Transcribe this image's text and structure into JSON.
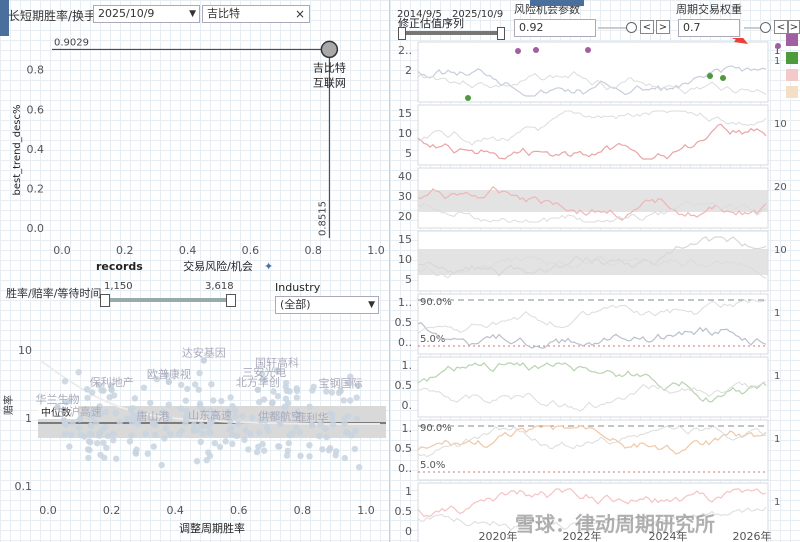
{
  "header": {
    "ratio_label": "长短期胜率/换手率",
    "date_value": "2025/10/9",
    "stock_name": "吉比特",
    "close_symbol": "×",
    "dropdown_symbol": "▼"
  },
  "top_right": {
    "date_range_label": "修正估值序列",
    "date_start": "2014/9/5",
    "date_end": "2025/10/9",
    "risk_label": "风险机会参数",
    "risk_value": "0.92",
    "weight_label": "周期交易权重",
    "weight_value": "0.7",
    "prev_symbol": "<",
    "next_symbol": ">"
  },
  "records": {
    "label": "records",
    "min": "1,150",
    "max": "3,618"
  },
  "industry": {
    "label": "Industry",
    "value": "(全部)"
  },
  "win_label": "胜率/赔率/等待时间",
  "colors": {
    "accent": "#e8413c",
    "purple": "#a05fa0",
    "green": "#4c9a3c",
    "pink": "#f4c9c9",
    "peach": "#f5dfc4",
    "dots": "#c8d3df"
  },
  "legend_swatches": [
    "1",
    "1"
  ],
  "chart_data": [
    {
      "type": "scatter",
      "ylabel": "best_trend_desc%",
      "xlabel": "交易风险/机会",
      "x_ticks": [
        "0.0",
        "0.2",
        "0.4",
        "0.6",
        "0.8",
        "1.0"
      ],
      "y_ticks": [
        "0.0",
        "0.2",
        "0.4",
        "0.6",
        "0.8"
      ],
      "xlim": [
        0,
        1
      ],
      "ylim": [
        0,
        0.92
      ],
      "point": {
        "x": 0.8515,
        "y": 0.9029,
        "name": "吉比特",
        "industry": "互联网"
      },
      "ref_x_label": "0.8515",
      "ref_y_label": "0.9029"
    },
    {
      "type": "scatter",
      "ylabel": "赔率",
      "xlabel": "调整周期胜率",
      "x_ticks": [
        "0.0",
        "0.2",
        "0.4",
        "0.6",
        "0.8",
        "1.0"
      ],
      "y_ticks": [
        "10",
        "1",
        "0.1"
      ],
      "y_scale": "log",
      "median_label": "中位数",
      "labels": [
        {
          "name": "达安基因",
          "x": 0.49,
          "y": 7.0
        },
        {
          "name": "国轩高科",
          "x": 0.72,
          "y": 5.0
        },
        {
          "name": "欧普康视",
          "x": 0.38,
          "y": 3.4
        },
        {
          "name": "三安光电",
          "x": 0.68,
          "y": 3.6
        },
        {
          "name": "保利地产",
          "x": 0.2,
          "y": 2.6
        },
        {
          "name": "北方华创",
          "x": 0.66,
          "y": 2.6
        },
        {
          "name": "宝钢国际",
          "x": 0.92,
          "y": 2.5
        },
        {
          "name": "华兰生物",
          "x": 0.03,
          "y": 1.45
        },
        {
          "name": "宁沪高速",
          "x": 0.1,
          "y": 0.95
        },
        {
          "name": "唐山港",
          "x": 0.33,
          "y": 0.82
        },
        {
          "name": "山东高速",
          "x": 0.51,
          "y": 0.85
        },
        {
          "name": "供都航空",
          "x": 0.73,
          "y": 0.82
        },
        {
          "name": "菲利华",
          "x": 0.83,
          "y": 0.78
        }
      ]
    },
    {
      "type": "line",
      "panels": [
        {
          "y_ticks": [
            "2..",
            "2"
          ],
          "right_label": "1"
        },
        {
          "y_ticks": [
            "15",
            "10",
            "5"
          ],
          "right_label": "10"
        },
        {
          "y_ticks": [
            "40",
            "30",
            "20"
          ],
          "right_label": "20"
        },
        {
          "y_ticks": [
            "15",
            "10",
            "5"
          ],
          "right_label": "10"
        },
        {
          "y_ticks": [
            "1..",
            "0.5",
            "0.."
          ],
          "right_label": "1",
          "pct_top": "90.0%",
          "pct_bottom": "5.0%"
        },
        {
          "y_ticks": [
            "1.",
            "0.5",
            "0."
          ],
          "right_label": "1"
        },
        {
          "y_ticks": [
            "1.",
            "0.5",
            "0.."
          ],
          "right_label": "1",
          "pct_top": "90.0%",
          "pct_bottom": "5.0%"
        },
        {
          "y_ticks": [
            "1",
            "0.5",
            "0"
          ],
          "right_label": "1"
        }
      ],
      "x_ticks": [
        "2020年",
        "2022年",
        "2024年",
        "2026年"
      ]
    }
  ],
  "watermark": "雪球：律动周期研究所"
}
